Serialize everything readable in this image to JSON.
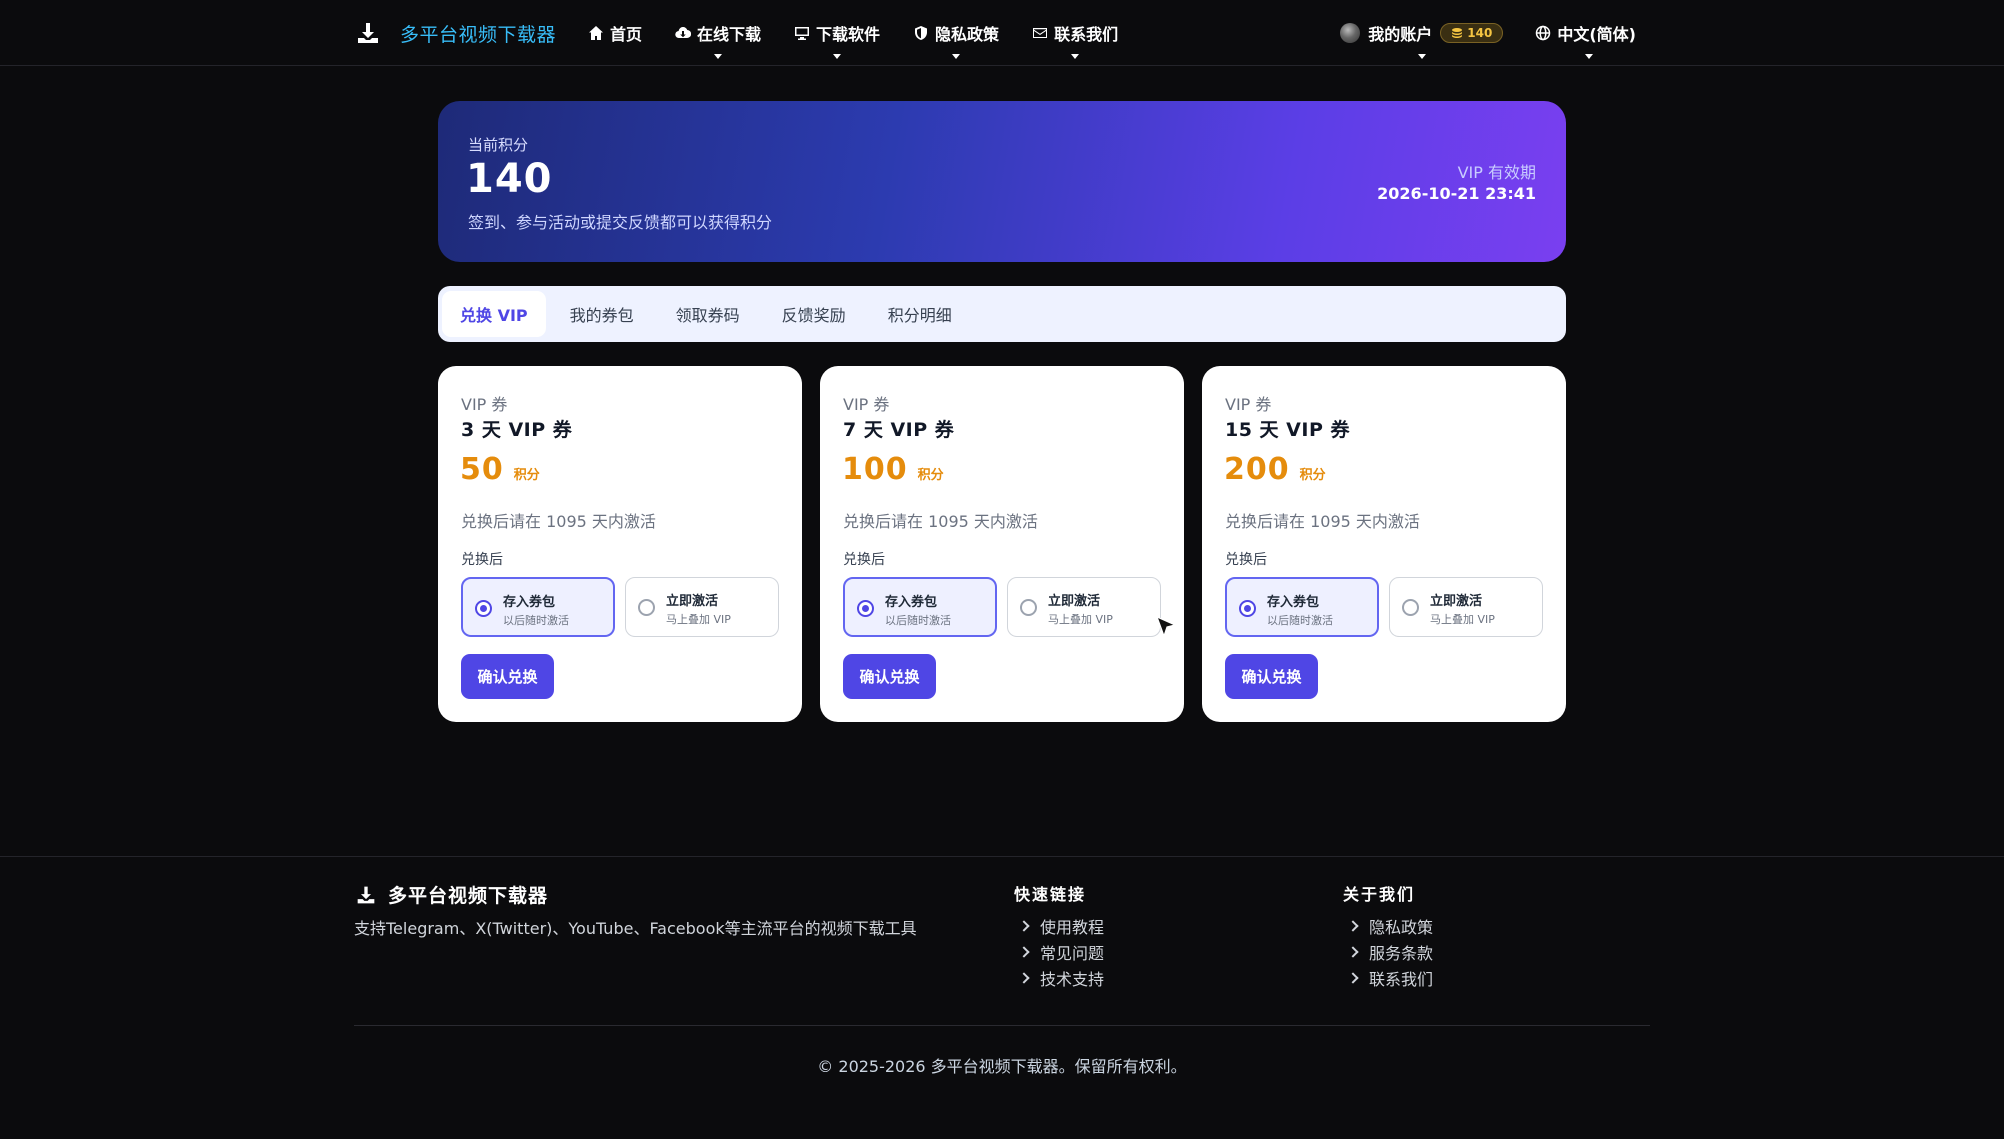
{
  "nav": {
    "brand": "多平台视频下载器",
    "items": [
      {
        "label": "首页",
        "icon": "home-icon",
        "caret": false
      },
      {
        "label": "在线下载",
        "icon": "cloud-download-icon",
        "caret": true
      },
      {
        "label": "下载软件",
        "icon": "desktop-icon",
        "caret": true
      },
      {
        "label": "隐私政策",
        "icon": "shield-icon",
        "caret": true
      },
      {
        "label": "联系我们",
        "icon": "envelope-icon",
        "caret": true
      }
    ],
    "account_label": "我的账户",
    "points_badge": "140",
    "language": "中文(简体)"
  },
  "hero": {
    "label": "当前积分",
    "value": "140",
    "description": "签到、参与活动或提交反馈都可以获得积分",
    "vip_label": "VIP 有效期",
    "vip_date": "2026-10-21 23:41"
  },
  "tabs": [
    {
      "label": "兑换 VIP",
      "active": true
    },
    {
      "label": "我的券包",
      "active": false
    },
    {
      "label": "领取券码",
      "active": false
    },
    {
      "label": "反馈奖励",
      "active": false
    },
    {
      "label": "积分明细",
      "active": false
    }
  ],
  "cards": [
    {
      "type": "VIP 券",
      "title": "3 天 VIP 券",
      "cost": "50",
      "unit": "积分",
      "desc": "兑换后请在 1095 天内激活",
      "after_label": "兑换后",
      "options": [
        {
          "title": "存入券包",
          "sub": "以后随时激活",
          "selected": true
        },
        {
          "title": "立即激活",
          "sub": "马上叠加 VIP",
          "selected": false
        }
      ],
      "button": "确认兑换"
    },
    {
      "type": "VIP 券",
      "title": "7 天 VIP 券",
      "cost": "100",
      "unit": "积分",
      "desc": "兑换后请在 1095 天内激活",
      "after_label": "兑换后",
      "options": [
        {
          "title": "存入券包",
          "sub": "以后随时激活",
          "selected": true
        },
        {
          "title": "立即激活",
          "sub": "马上叠加 VIP",
          "selected": false
        }
      ],
      "button": "确认兑换"
    },
    {
      "type": "VIP 券",
      "title": "15 天 VIP 券",
      "cost": "200",
      "unit": "积分",
      "desc": "兑换后请在 1095 天内激活",
      "after_label": "兑换后",
      "options": [
        {
          "title": "存入券包",
          "sub": "以后随时激活",
          "selected": true
        },
        {
          "title": "立即激活",
          "sub": "马上叠加 VIP",
          "selected": false
        }
      ],
      "button": "确认兑换"
    }
  ],
  "footer": {
    "brand": "多平台视频下载器",
    "description": "支持Telegram、X(Twitter)、YouTube、Facebook等主流平台的视频下载工具",
    "quick_links": {
      "title": "快速链接",
      "items": [
        "使用教程",
        "常见问题",
        "技术支持"
      ]
    },
    "about": {
      "title": "关于我们",
      "items": [
        "隐私政策",
        "服务条款",
        "联系我们"
      ]
    },
    "copyright": "© 2025-2026 多平台视频下载器。保留所有权利。"
  },
  "colors": {
    "accent": "#4f46e5",
    "brand_text": "#38bdf8",
    "cost": "#e58c0c",
    "background": "#0b0b0d"
  }
}
